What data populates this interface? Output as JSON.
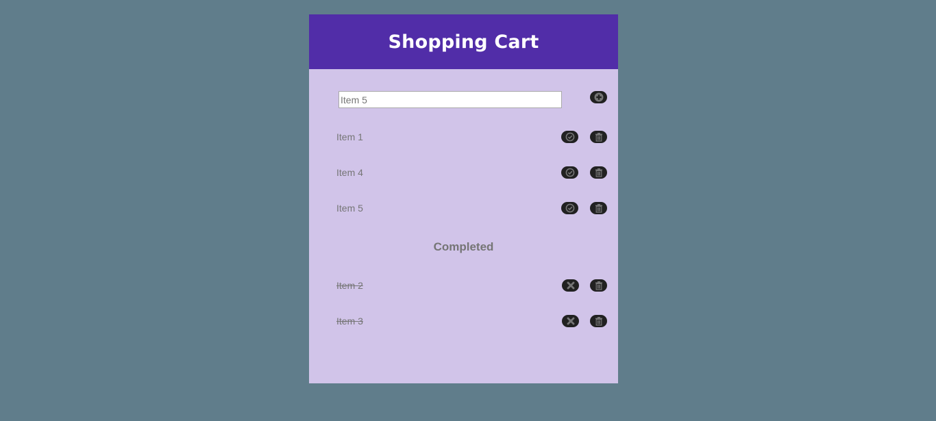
{
  "header": {
    "title": "Shopping Cart"
  },
  "add_form": {
    "input_value": "Item 5",
    "add_icon": "plus-icon"
  },
  "active_items": [
    {
      "label": "Item 1"
    },
    {
      "label": "Item 4"
    },
    {
      "label": "Item 5"
    }
  ],
  "completed_section": {
    "title": "Completed"
  },
  "completed_items": [
    {
      "label": "Item 2"
    },
    {
      "label": "Item 3"
    }
  ],
  "colors": {
    "background": "#607d8b",
    "header": "#512da8",
    "card": "#d1c4e9",
    "button": "#212121",
    "icon": "#757575"
  }
}
